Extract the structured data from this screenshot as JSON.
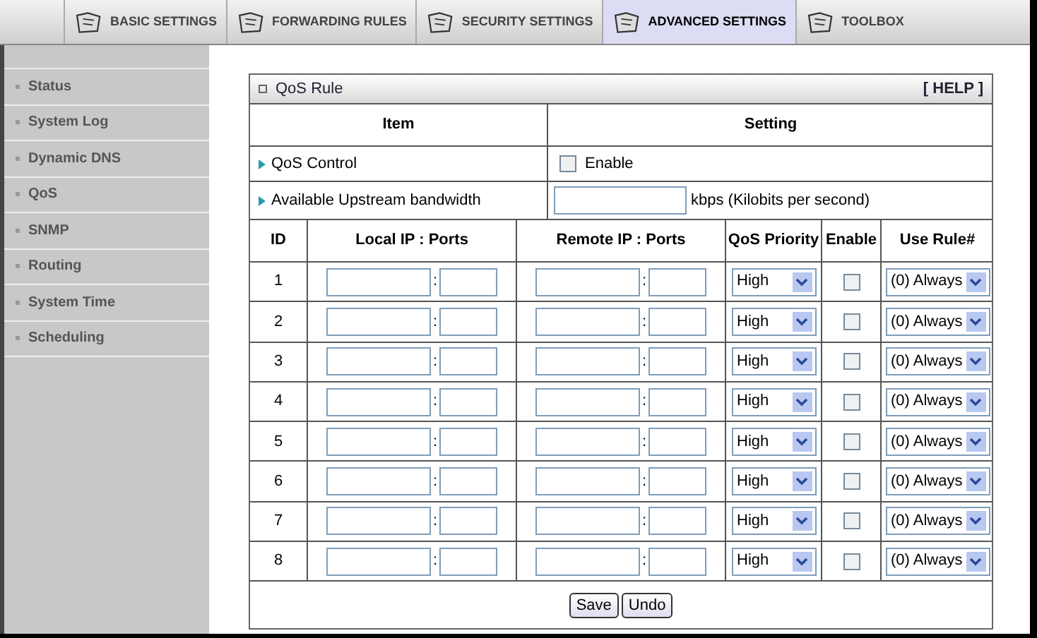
{
  "tabs": [
    {
      "label": "BASIC SETTINGS",
      "selected": false
    },
    {
      "label": "FORWARDING RULES",
      "selected": false
    },
    {
      "label": "SECURITY SETTINGS",
      "selected": false
    },
    {
      "label": "ADVANCED SETTINGS",
      "selected": true
    },
    {
      "label": "TOOLBOX",
      "selected": false
    }
  ],
  "sidebar": {
    "items": [
      "Status",
      "System Log",
      "Dynamic DNS",
      "QoS",
      "SNMP",
      "Routing",
      "System Time",
      "Scheduling"
    ]
  },
  "panel": {
    "title": "QoS Rule",
    "help": "[ HELP ]"
  },
  "settings": {
    "columns": [
      "Item",
      "Setting"
    ],
    "qos_control": {
      "label": "QoS Control",
      "checked": false,
      "option": "Enable"
    },
    "bandwidth": {
      "label": "Available Upstream bandwidth",
      "unit": "kbps (Kilobits per second)"
    }
  },
  "rules": {
    "columns": [
      "ID",
      "Local IP : Ports",
      "Remote IP : Ports",
      "QoS Priority",
      "Enable",
      "Use Rule#"
    ],
    "separator": ":",
    "rows": [
      {
        "id": "1",
        "priority": "High",
        "enabled": false,
        "rule": "(0) Always"
      },
      {
        "id": "2",
        "priority": "High",
        "enabled": false,
        "rule": "(0) Always"
      },
      {
        "id": "3",
        "priority": "High",
        "enabled": false,
        "rule": "(0) Always"
      },
      {
        "id": "4",
        "priority": "High",
        "enabled": false,
        "rule": "(0) Always"
      },
      {
        "id": "5",
        "priority": "High",
        "enabled": false,
        "rule": "(0) Always"
      },
      {
        "id": "6",
        "priority": "High",
        "enabled": false,
        "rule": "(0) Always"
      },
      {
        "id": "7",
        "priority": "High",
        "enabled": false,
        "rule": "(0) Always"
      },
      {
        "id": "8",
        "priority": "High",
        "enabled": false,
        "rule": "(0) Always"
      }
    ]
  },
  "buttons": [
    "Save",
    "Undo"
  ]
}
